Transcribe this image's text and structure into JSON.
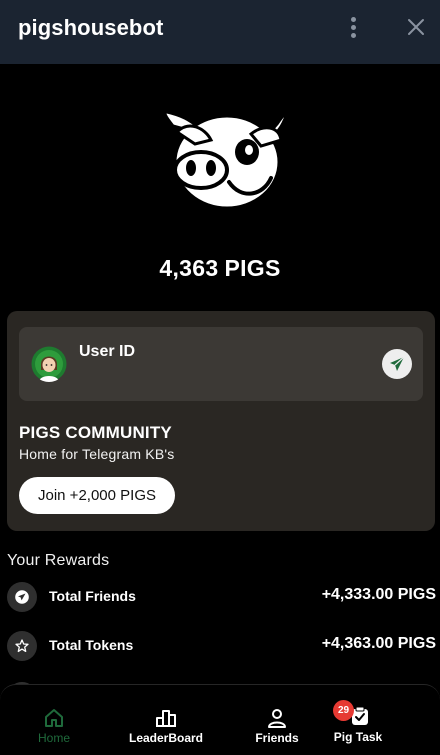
{
  "header": {
    "title": "pigshousebot"
  },
  "balance": {
    "amount": "4,363",
    "unit": "PIGS"
  },
  "user_card": {
    "label": "User ID"
  },
  "community": {
    "title": "PIGS COMMUNITY",
    "subtitle": "Home for Telegram KB's",
    "join_label": "Join +2,000 PIGS"
  },
  "rewards": {
    "title": "Your Rewards",
    "items": [
      {
        "label": "Total Friends",
        "value": "+4,333.00 PIGS",
        "icon": "telegram-icon"
      },
      {
        "label": "Total Tokens",
        "value": "+4,363.00 PIGS",
        "icon": "star-icon"
      }
    ]
  },
  "nav": {
    "tabs": [
      {
        "label": "Home",
        "icon": "home-icon",
        "active": true
      },
      {
        "label": "LeaderBoard",
        "icon": "leaderboard-icon"
      },
      {
        "label": "Friends",
        "icon": "person-icon"
      },
      {
        "label": "Pig Task",
        "icon": "task-icon",
        "badge": "29"
      }
    ]
  },
  "colors": {
    "header_bg": "#1b2431",
    "card_bg": "#2a2723",
    "active_tab": "#1f6a3b",
    "badge": "#e63a33",
    "send_icon": "#1f6a3b"
  }
}
